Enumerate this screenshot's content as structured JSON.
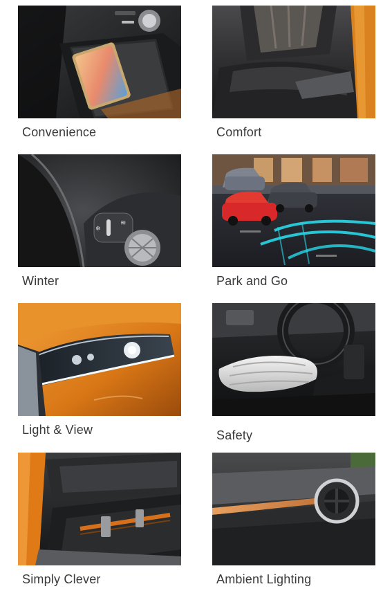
{
  "cards": [
    {
      "label": "Convenience"
    },
    {
      "label": "Comfort"
    },
    {
      "label": "Winter"
    },
    {
      "label": "Park and Go"
    },
    {
      "label": "Light & View"
    },
    {
      "label": "Safety"
    },
    {
      "label": "Simply Clever"
    },
    {
      "label": "Ambient Lighting"
    }
  ],
  "colors": {
    "label_text": "#3a3a3a",
    "car_orange": "#e07a17",
    "interior_dark": "#1e1f21",
    "led_cyan": "#29d7e8",
    "car_red": "#d8282a"
  }
}
